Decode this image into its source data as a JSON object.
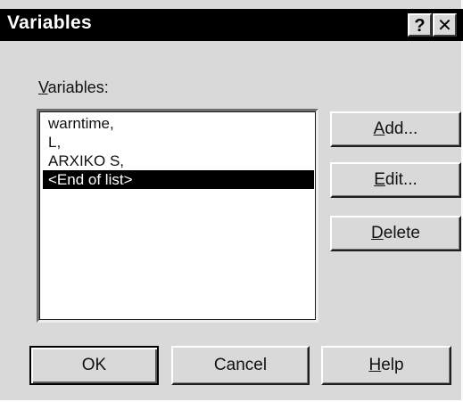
{
  "window": {
    "title": "Variables",
    "help_glyph": "?",
    "close_glyph": "✕"
  },
  "label": {
    "mnemonic": "V",
    "rest": "ariables:"
  },
  "list": {
    "items": [
      "warntime,",
      "L,",
      "ARXIKO S,",
      "<End of list>"
    ],
    "selected_index": 3
  },
  "buttons": {
    "add": {
      "mnemonic": "A",
      "rest": "dd..."
    },
    "edit": {
      "mnemonic": "E",
      "rest": "dit..."
    },
    "delete": {
      "mnemonic": "D",
      "rest": "elete"
    },
    "ok": {
      "label": "OK"
    },
    "cancel": {
      "label": "Cancel"
    },
    "help": {
      "mnemonic": "H",
      "rest": "elp"
    }
  },
  "colors": {
    "dialog_bg": "#d9d9d9",
    "title_bg": "#000000",
    "selection_bg": "#000000"
  }
}
